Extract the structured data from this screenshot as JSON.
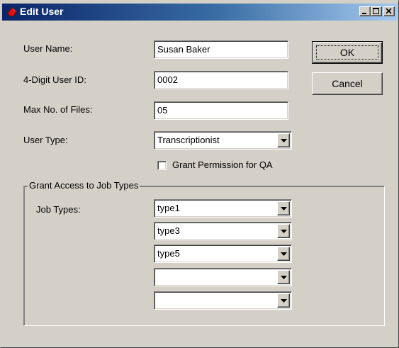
{
  "window": {
    "title": "Edit User",
    "controls": [
      "minimize-icon",
      "maximize-icon",
      "close-icon"
    ]
  },
  "form": {
    "user_name": {
      "label": "User Name:",
      "value": "Susan Baker"
    },
    "user_id": {
      "label": "4-Digit User ID:",
      "value": "0002"
    },
    "max_files": {
      "label": "Max No. of Files:",
      "value": "05"
    },
    "user_type": {
      "label": "User Type:",
      "value": "Transcriptionist"
    },
    "grant_qa": {
      "label": "Grant Permission for QA",
      "checked": false
    }
  },
  "group": {
    "title": "Grant Access to Job Types",
    "job_types_label": "Job Types:",
    "job_types": [
      "type1",
      "type3",
      "type5",
      "",
      ""
    ]
  },
  "buttons": {
    "ok": "OK",
    "cancel": "Cancel"
  },
  "colors": {
    "face": "#d4d0c8",
    "title_start": "#0a246a",
    "title_end": "#a6caf0",
    "title_icon": "#e01010"
  }
}
